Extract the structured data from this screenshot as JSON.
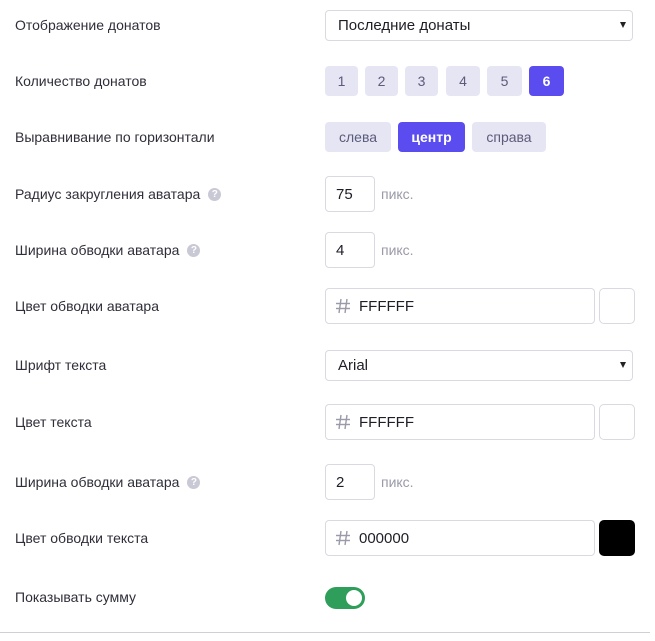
{
  "rows": {
    "display": {
      "label": "Отображение донатов",
      "value": "Последние донаты"
    },
    "count": {
      "label": "Количество донатов",
      "options": [
        "1",
        "2",
        "3",
        "4",
        "5",
        "6"
      ],
      "selected": "6"
    },
    "align": {
      "label": "Выравнивание по горизонтали",
      "options": [
        "слева",
        "центр",
        "справа"
      ],
      "selected": "центр"
    },
    "avatar_radius": {
      "label": "Радиус закругления аватара",
      "value": "75",
      "unit": "пикс."
    },
    "avatar_border_width": {
      "label": "Ширина обводки аватара",
      "value": "4",
      "unit": "пикс."
    },
    "avatar_border_color": {
      "label": "Цвет обводки аватара",
      "value": "FFFFFF",
      "swatch": "#FFFFFF"
    },
    "font": {
      "label": "Шрифт текста",
      "value": "Arial"
    },
    "text_color": {
      "label": "Цвет текста",
      "value": "FFFFFF",
      "swatch": "#FFFFFF"
    },
    "text_border_width": {
      "label": "Ширина обводки аватара",
      "value": "2",
      "unit": "пикс."
    },
    "text_border_color": {
      "label": "Цвет обводки текста",
      "value": "000000",
      "swatch": "#000000"
    },
    "show_amount": {
      "label": "Показывать сумму",
      "on": true
    }
  },
  "colors": {
    "accent": "#5B4CF0",
    "pill": "#E6E5F4",
    "toggle_on": "#2F9E5A"
  },
  "icons": {
    "help": "question-circle-icon",
    "hash": "hash-icon",
    "caret": "caret-down-icon"
  }
}
